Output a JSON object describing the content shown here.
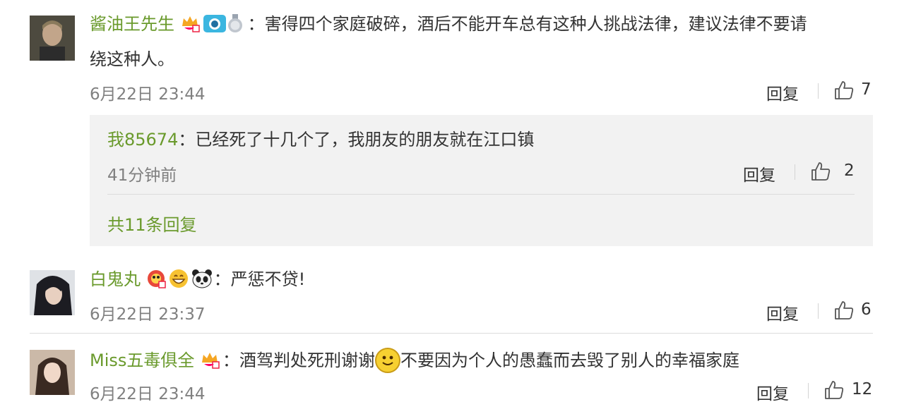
{
  "comments": [
    {
      "user": "酱油王先生",
      "colon": "：",
      "text_line1": "害得四个家庭破碎，酒后不能开车总有这种人挑战法律，建议法律不要请",
      "text_line2": "绕这种人。",
      "time": "6月22日 23:44",
      "reply_label": "回复",
      "likes": "7",
      "badges": [
        "vip-crown-icon",
        "camera-icon",
        "medal-icon"
      ]
    },
    {
      "user": "白鬼丸",
      "colon": "：",
      "text": "严惩不贷!",
      "time": "6月22日 23:37",
      "reply_label": "回复",
      "likes": "6",
      "badges": [
        "lion-dance-icon",
        "grin-emoji-icon",
        "panda-icon"
      ]
    },
    {
      "user": "Miss五毒俱全",
      "colon": "：",
      "text_before": "酒驾判处死刑谢谢",
      "text_after": "不要因为个人的愚蠢而去毁了别人的幸福家庭",
      "time": "6月22日 23:44",
      "reply_label": "回复",
      "likes": "12",
      "badges": [
        "vip-crown-icon"
      ]
    }
  ],
  "sub_reply": {
    "user": "我85674",
    "colon": "：",
    "text": "已经死了十几个了，我朋友的朋友就在江口镇",
    "time": "41分钟前",
    "reply_label": "回复",
    "likes": "2",
    "more_replies": "共11条回复"
  },
  "colors": {
    "username": "#6a9a2c",
    "text": "#333333",
    "muted": "#808080",
    "reply_bg": "#f2f2f2"
  }
}
